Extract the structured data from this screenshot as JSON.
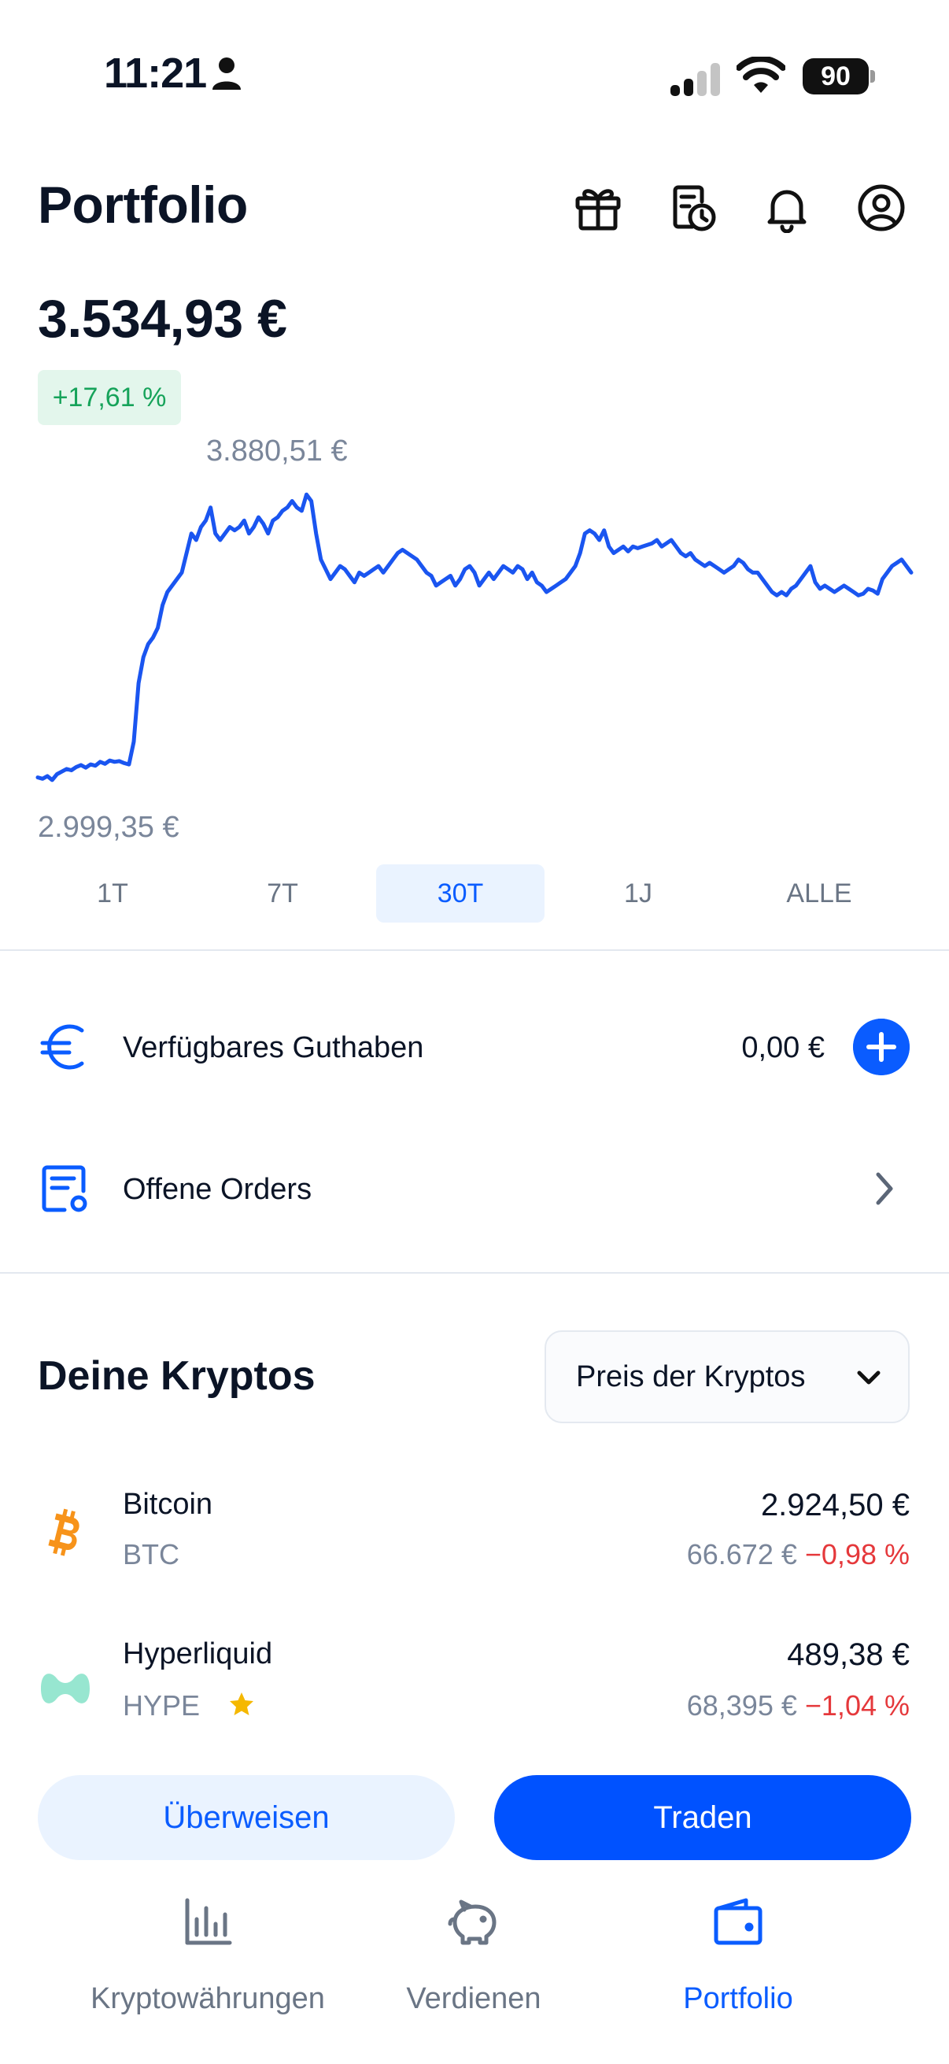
{
  "status_bar": {
    "time": "11:21",
    "battery": "90"
  },
  "header": {
    "title": "Portfolio",
    "icons": [
      "gift-icon",
      "history-icon",
      "bell-icon",
      "profile-icon"
    ]
  },
  "portfolio": {
    "total": "3.534,93 €",
    "change": "+17,61 %",
    "chart_high_label": "3.880,51 €",
    "chart_low_label": "2.999,35 €"
  },
  "chart_data": {
    "type": "line",
    "color": "#1a55f0",
    "ylim": [
      2999.35,
      3880.51
    ],
    "values": [
      3010,
      3006,
      3014,
      3002,
      3020,
      3028,
      3036,
      3032,
      3042,
      3048,
      3040,
      3050,
      3046,
      3058,
      3052,
      3062,
      3058,
      3060,
      3054,
      3050,
      3120,
      3300,
      3380,
      3420,
      3440,
      3470,
      3540,
      3580,
      3600,
      3620,
      3640,
      3700,
      3760,
      3740,
      3780,
      3800,
      3840,
      3760,
      3740,
      3760,
      3780,
      3770,
      3780,
      3800,
      3760,
      3780,
      3810,
      3790,
      3760,
      3800,
      3810,
      3830,
      3840,
      3860,
      3840,
      3830,
      3880,
      3860,
      3760,
      3680,
      3650,
      3620,
      3640,
      3660,
      3650,
      3630,
      3610,
      3640,
      3630,
      3640,
      3650,
      3660,
      3640,
      3660,
      3680,
      3700,
      3710,
      3700,
      3690,
      3680,
      3660,
      3640,
      3630,
      3600,
      3610,
      3620,
      3630,
      3600,
      3620,
      3650,
      3660,
      3640,
      3600,
      3620,
      3640,
      3620,
      3640,
      3660,
      3650,
      3640,
      3660,
      3650,
      3620,
      3640,
      3610,
      3600,
      3580,
      3590,
      3600,
      3610,
      3620,
      3640,
      3660,
      3700,
      3760,
      3770,
      3760,
      3740,
      3770,
      3720,
      3700,
      3710,
      3720,
      3705,
      3720,
      3715,
      3720,
      3725,
      3730,
      3740,
      3720,
      3730,
      3740,
      3720,
      3700,
      3690,
      3700,
      3680,
      3670,
      3660,
      3670,
      3660,
      3650,
      3640,
      3650,
      3660,
      3680,
      3670,
      3650,
      3640,
      3640,
      3620,
      3600,
      3580,
      3570,
      3580,
      3570,
      3590,
      3600,
      3620,
      3640,
      3660,
      3610,
      3590,
      3600,
      3590,
      3580,
      3590,
      3600,
      3590,
      3580,
      3570,
      3575,
      3590,
      3585,
      3575,
      3620,
      3640,
      3660,
      3670,
      3680,
      3660,
      3640
    ]
  },
  "ranges": [
    "1T",
    "7T",
    "30T",
    "1J",
    "ALLE"
  ],
  "active_range": "30T",
  "balance": {
    "label": "Verfügbares Guthaben",
    "value": "0,00 €"
  },
  "orders": {
    "label": "Offene Orders"
  },
  "cryptos": {
    "title": "Deine Kryptos",
    "sort_label": "Preis der Kryptos",
    "items": [
      {
        "name": "Bitcoin",
        "symbol": "BTC",
        "value": "2.924,50 €",
        "price": "66.672 €",
        "change": "−0,98 %",
        "logo_color": "#f7931a",
        "logo": "bitcoin-logo"
      },
      {
        "name": "Hyperliquid",
        "symbol": "HYPE",
        "value": "489,38 €",
        "price": "68,395 €",
        "change": "−1,04 %",
        "logo_color": "#97e6d0",
        "logo": "hyperliquid-logo",
        "favorite": true
      }
    ]
  },
  "actions": {
    "transfer": "Überweisen",
    "trade": "Traden"
  },
  "nav": [
    {
      "label": "Kryptowährungen",
      "icon": "bar-chart-icon",
      "active": false
    },
    {
      "label": "Verdienen",
      "icon": "piggy-bank-icon",
      "active": false
    },
    {
      "label": "Portfolio",
      "icon": "wallet-icon",
      "active": true
    }
  ],
  "colors": {
    "accent": "#0a5cff",
    "positive": "#16a35a",
    "negative": "#e5383b",
    "muted": "#7a869a"
  }
}
